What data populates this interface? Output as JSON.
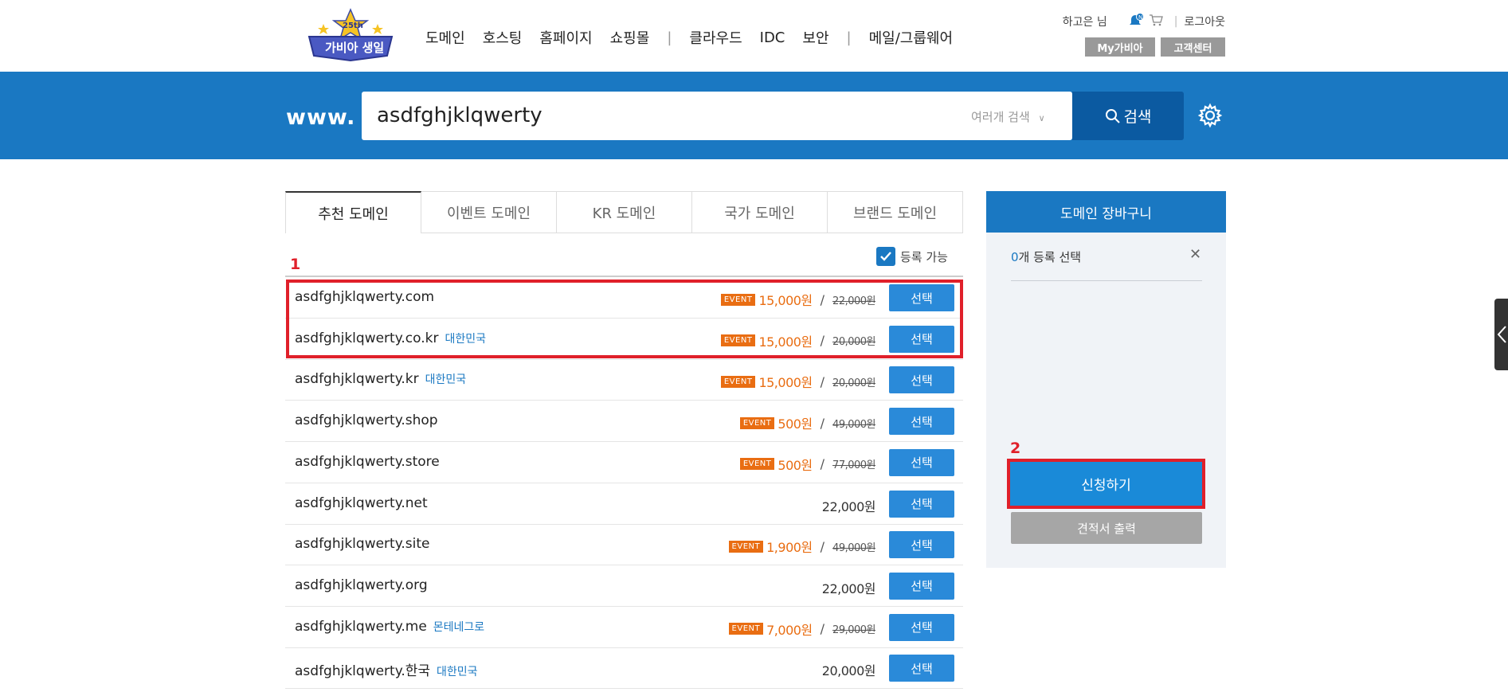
{
  "header": {
    "logo_text": "가비아 생일",
    "logo_badge": "25th",
    "nav": [
      "도메인",
      "호스팅",
      "홈페이지",
      "쇼핑몰",
      "클라우드",
      "IDC",
      "보안",
      "메일/그룹웨어"
    ],
    "user_name": "하고은 님",
    "logout": "로그아웃",
    "my_gabia": "My가비아",
    "customer_center": "고객센터",
    "notification_count": "N"
  },
  "search": {
    "prefix": "www.",
    "query": "asdfghjklqwerty",
    "multi_search": "여러개 검색",
    "button": "검색"
  },
  "tabs": [
    "추천 도메인",
    "이벤트 도메인",
    "KR 도메인",
    "국가 도메인",
    "브랜드 도메인"
  ],
  "filter": {
    "available_label": "등록 가능"
  },
  "annotations": {
    "box1": "1",
    "box2": "2"
  },
  "event_badge": "EVENT",
  "select_label": "선택",
  "domains": [
    {
      "name": "asdfghjklqwerty.com",
      "country": "",
      "event": true,
      "sale": "15,000원",
      "orig": "22,000원",
      "price": ""
    },
    {
      "name": "asdfghjklqwerty.co.kr",
      "country": "대한민국",
      "event": true,
      "sale": "15,000원",
      "orig": "20,000원",
      "price": ""
    },
    {
      "name": "asdfghjklqwerty.kr",
      "country": "대한민국",
      "event": true,
      "sale": "15,000원",
      "orig": "20,000원",
      "price": ""
    },
    {
      "name": "asdfghjklqwerty.shop",
      "country": "",
      "event": true,
      "sale": "500원",
      "orig": "49,000원",
      "price": ""
    },
    {
      "name": "asdfghjklqwerty.store",
      "country": "",
      "event": true,
      "sale": "500원",
      "orig": "77,000원",
      "price": ""
    },
    {
      "name": "asdfghjklqwerty.net",
      "country": "",
      "event": false,
      "sale": "",
      "orig": "",
      "price": "22,000원"
    },
    {
      "name": "asdfghjklqwerty.site",
      "country": "",
      "event": true,
      "sale": "1,900원",
      "orig": "49,000원",
      "price": ""
    },
    {
      "name": "asdfghjklqwerty.org",
      "country": "",
      "event": false,
      "sale": "",
      "orig": "",
      "price": "22,000원"
    },
    {
      "name": "asdfghjklqwerty.me",
      "country": "몬테네그로",
      "event": true,
      "sale": "7,000원",
      "orig": "29,000원",
      "price": ""
    },
    {
      "name": "asdfghjklqwerty.한국",
      "country": "대한민국",
      "event": false,
      "sale": "",
      "orig": "",
      "price": "20,000원"
    }
  ],
  "cart": {
    "title": "도메인 장바구니",
    "count": "0",
    "count_suffix": "개 등록 선택",
    "close": "✕",
    "apply": "신청하기",
    "estimate": "견적서 출력"
  },
  "colors": {
    "primary": "#1a78c2",
    "event": "#e96d12",
    "highlight": "#e0202a"
  }
}
